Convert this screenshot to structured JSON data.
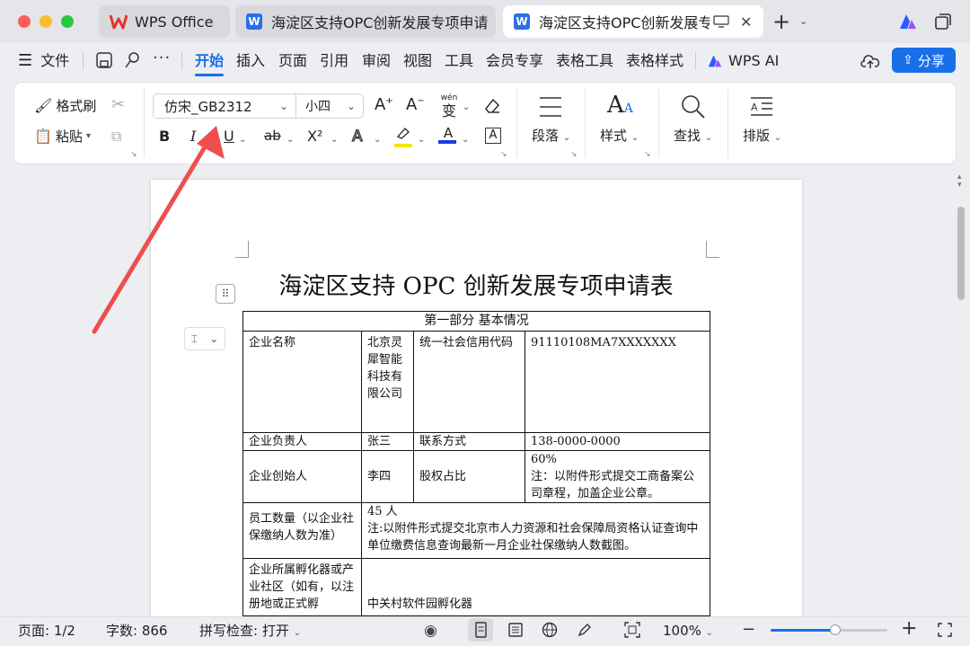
{
  "titlebar": {
    "tabs": [
      {
        "label": "WPS Office"
      },
      {
        "label": "海淀区支持OPC创新发展专项申请"
      },
      {
        "label": "海淀区支持OPC创新发展专项申请"
      }
    ],
    "active_tab": 2,
    "window_controls": [
      "close",
      "minimize",
      "zoom"
    ]
  },
  "menubar": {
    "file": "文件",
    "tabs": [
      "开始",
      "插入",
      "页面",
      "引用",
      "审阅",
      "视图",
      "工具",
      "会员专享",
      "表格工具",
      "表格样式"
    ],
    "active_tab": "开始",
    "ai": "WPS AI",
    "share": "分享"
  },
  "ribbon": {
    "format_painter": "格式刷",
    "paste": "粘贴",
    "font_name": "仿宋_GB2312",
    "font_size": "小四",
    "pinyin_top": "wén",
    "pinyin_char": "变",
    "bold": "B",
    "italic": "I",
    "underline": "U",
    "strike": "ab",
    "superscript": "X²",
    "font_effect": "A",
    "char_border": "A",
    "paragraph": "段落",
    "styles": "样式",
    "find": "查找",
    "layout": "排版"
  },
  "document": {
    "title": "海淀区支持 OPC 创新发展专项申请表",
    "section_header": "第一部分  基本情况",
    "rows": {
      "company_label": "企业名称",
      "company_value": "北京灵犀智能科技有限公司",
      "credit_label": "统一社会信用代码",
      "credit_value": "91110108MA7XXXXXXX",
      "owner_label": "企业负责人",
      "owner_value": "张三",
      "contact_label": "联系方式",
      "contact_value": "138-0000-0000",
      "founder_label": "企业创始人",
      "founder_value": "李四",
      "equity_label": "股权占比",
      "equity_value": "60%",
      "equity_note": "注：以附件形式提交工商备案公司章程，加盖企业公章。",
      "staff_label": "员工数量（以企业社保缴纳人数为准）",
      "staff_value": "45 人",
      "staff_note": "注:以附件形式提交北京市人力资源和社会保障局资格认证查询中单位缴费信息查询最新一月企业社保缴纳人数截图。",
      "incubator_label": "企业所属孵化器或产业社区（如有，以注册地或正式孵",
      "incubator_value": "中关村软件园孵化器"
    }
  },
  "statusbar": {
    "page": "页面: 1/2",
    "words": "字数: 866",
    "spellcheck": "拼写检查: 打开",
    "zoom": "100%",
    "zoom_level": 0.55
  },
  "colors": {
    "accent": "#1a6fe8",
    "arrow": "#ef4e4e",
    "wps_red": "#e8312f",
    "highlight": "#f5e60a",
    "font_color": "#1a3de0"
  }
}
